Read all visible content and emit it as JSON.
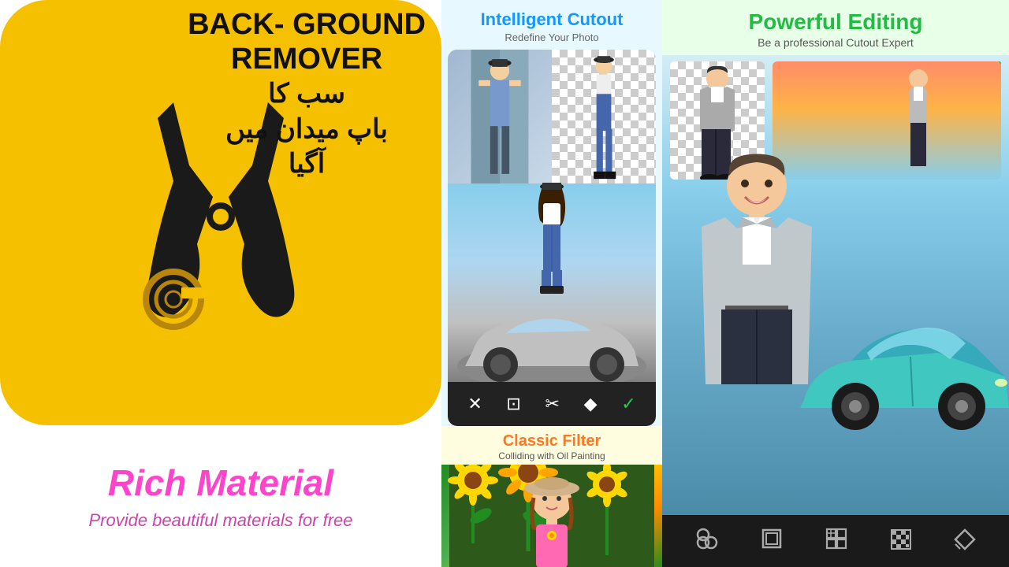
{
  "left": {
    "headline_line1": "BACK-",
    "headline_line2": "GROUND",
    "headline_line3": "REMOVER",
    "headline_urdu1": "سب کا",
    "headline_urdu2": "باپ میدان میں",
    "headline_urdu3": "آگیا",
    "rich_material_title": "Rich Material",
    "rich_material_sub": "Provide beautiful materials for free"
  },
  "middle": {
    "intelligent_cutout_title": "Intelligent Cutout",
    "intelligent_cutout_sub": "Redefine Your Photo",
    "toolbar_icons": [
      "✕",
      "⊡",
      "✂",
      "◆",
      "✓"
    ],
    "classic_filter_title": "Classic Filter",
    "classic_filter_sub": "Colliding with Oil Painting"
  },
  "right": {
    "powerful_editing_title": "Powerful Editing",
    "powerful_editing_sub": "Be a professional Cutout Expert",
    "toolbar_icons": [
      "⊙",
      "⊟",
      "▦",
      "⊞",
      "◇"
    ]
  }
}
